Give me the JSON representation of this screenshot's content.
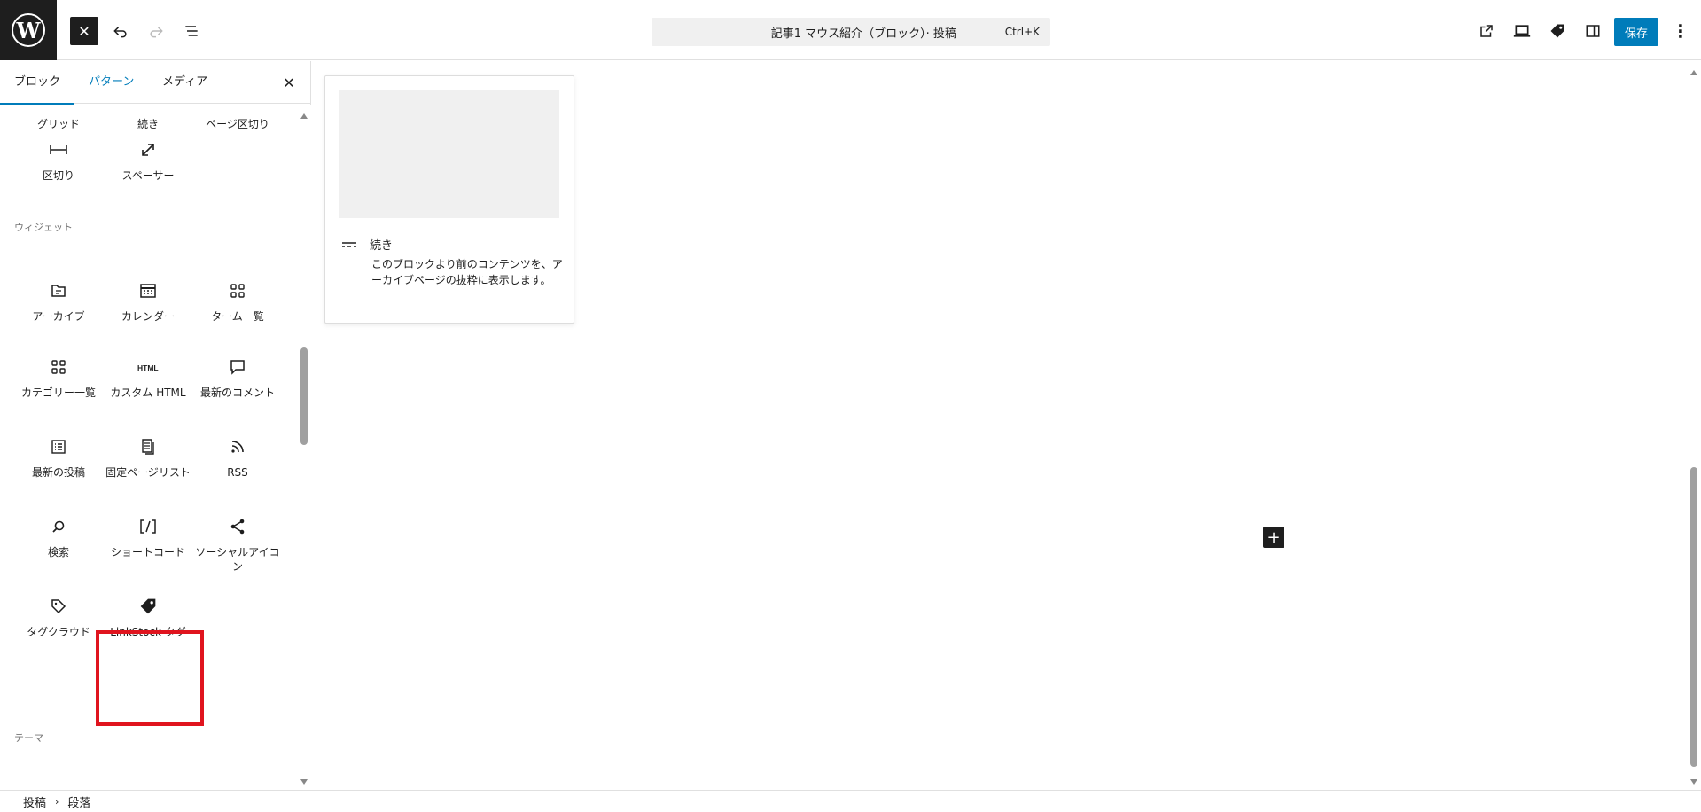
{
  "header": {
    "document_title": "記事1 マウス紹介（ブロック）· 投稿",
    "shortcut": "Ctrl+K",
    "save_label": "保存"
  },
  "inserter": {
    "tabs": [
      {
        "label": "ブロック",
        "active": false
      },
      {
        "label": "パターン",
        "active": true
      },
      {
        "label": "メディア",
        "active": false
      }
    ],
    "categories": {
      "design_tail": [
        "グリッド",
        "続き",
        "ページ区切り",
        "区切り",
        "スペーサー"
      ],
      "widgets_title": "ウィジェット",
      "widgets": [
        {
          "label": "アーカイブ",
          "icon": "archive-icon"
        },
        {
          "label": "カレンダー",
          "icon": "calendar-icon"
        },
        {
          "label": "ターム一覧",
          "icon": "term-list-icon"
        },
        {
          "label": "カテゴリー一覧",
          "icon": "categories-icon"
        },
        {
          "label": "カスタム HTML",
          "icon": "html-icon"
        },
        {
          "label": "最新のコメント",
          "icon": "comment-icon"
        },
        {
          "label": "最新の投稿",
          "icon": "latest-posts-icon"
        },
        {
          "label": "固定ページリスト",
          "icon": "page-list-icon"
        },
        {
          "label": "RSS",
          "icon": "rss-icon"
        },
        {
          "label": "検索",
          "icon": "search-icon"
        },
        {
          "label": "ショートコード",
          "icon": "shortcode-icon"
        },
        {
          "label": "ソーシャルアイコン",
          "icon": "share-icon"
        },
        {
          "label": "タグクラウド",
          "icon": "tag-icon"
        },
        {
          "label": "LinkStock タグ",
          "icon": "tag-filled-icon"
        }
      ],
      "theme_title": "テーマ"
    }
  },
  "preview": {
    "title": "続き",
    "description": "このブロックより前のコンテンツを、アーカイブページの抜粋に表示します。"
  },
  "footer": {
    "breadcrumb": [
      "投稿",
      "段落"
    ]
  },
  "colors": {
    "accent": "#007cba",
    "highlight": "#e0141e",
    "dark": "#1e1e1e"
  }
}
